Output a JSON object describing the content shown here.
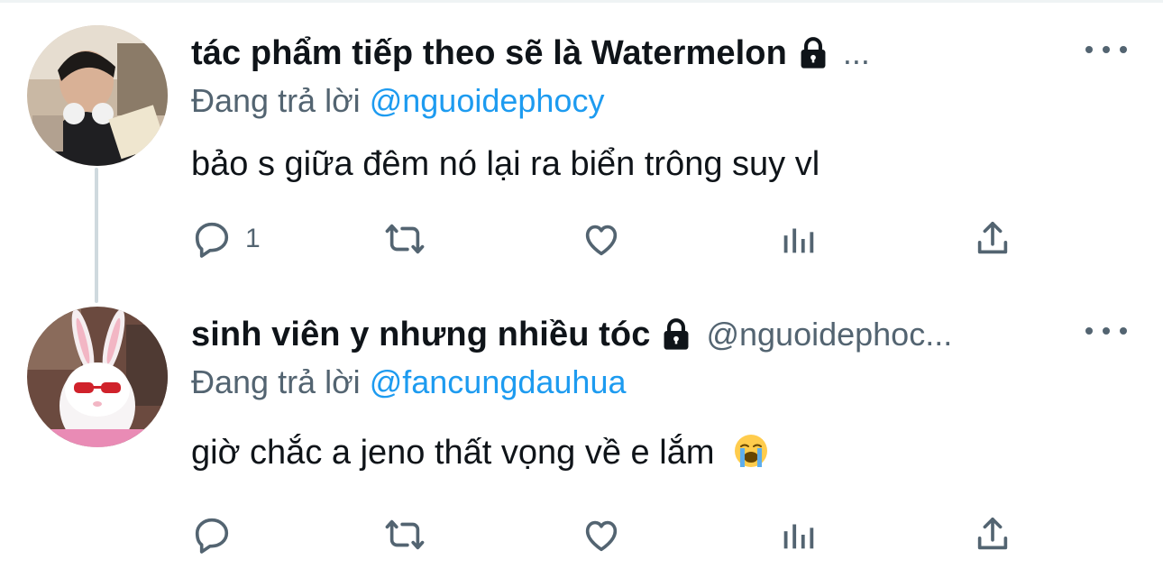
{
  "thread": [
    {
      "author_name": "tác phẩm tiếp theo sẽ là Watermelon",
      "handle": "...",
      "replying_prefix": "Đang trả lời",
      "replying_to": "@nguoidephocy",
      "text": "bảo s giữa đêm nó lại ra biển trông suy vl",
      "reply_count": "1",
      "icons": [
        "lock-icon",
        "more-icon",
        "reply-icon",
        "retweet-icon",
        "like-icon",
        "analytics-icon",
        "share-icon"
      ]
    },
    {
      "author_name": "sinh viên y nhưng nhiều tóc",
      "handle": "@nguoidephoc...",
      "replying_prefix": "Đang trả lời",
      "replying_to": "@fancungdauhua",
      "text": "giờ chắc a jeno thất vọng về e lắm",
      "emoji": "loudly-crying-face",
      "reply_count": "",
      "icons": [
        "lock-icon",
        "more-icon",
        "reply-icon",
        "retweet-icon",
        "like-icon",
        "analytics-icon",
        "share-icon"
      ]
    }
  ],
  "colors": {
    "text": "#0f1419",
    "muted": "#536471",
    "link": "#1d9bf0",
    "thread_line": "#cfd9de"
  }
}
